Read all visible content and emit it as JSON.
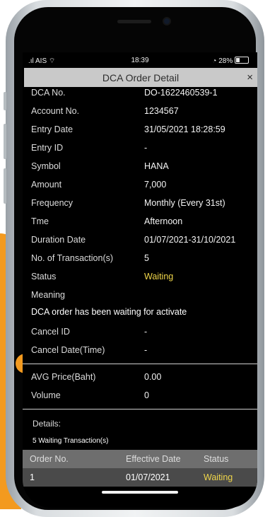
{
  "statusbar": {
    "carrier": ".ıl AIS",
    "time": "18:39",
    "battery": "28%"
  },
  "header": {
    "title": "DCA Order Detail",
    "close": "×"
  },
  "details": [
    {
      "label": "DCA No.",
      "value": "DO-1622460539-1"
    },
    {
      "label": "Account No.",
      "value": "1234567"
    },
    {
      "label": "Entry Date",
      "value": "31/05/2021  18:28:59"
    },
    {
      "label": "Entry ID",
      "value": "-"
    },
    {
      "label": "Symbol",
      "value": "HANA"
    },
    {
      "label": "Amount",
      "value": "7,000"
    },
    {
      "label": "Frequency",
      "value": "Monthly (Every 31st)"
    },
    {
      "label": "Tme",
      "value": "Afternoon"
    },
    {
      "label": "Duration Date",
      "value": "01/07/2021-31/10/2021"
    },
    {
      "label": "No. of Transaction(s)",
      "value": "5"
    },
    {
      "label": "Status",
      "value": "Waiting"
    }
  ],
  "meaning": {
    "label": "Meaning",
    "text": "DCA order has been waiting for activate"
  },
  "cancel": [
    {
      "label": "Cancel ID",
      "value": "-"
    },
    {
      "label": "Cancel Date(Time)",
      "value": "-"
    }
  ],
  "summary": [
    {
      "label": "AVG Price(Baht)",
      "value": "0.00"
    },
    {
      "label": "Volume",
      "value": "0"
    }
  ],
  "details_section": {
    "label": "Details:",
    "waiting": "5 Waiting Transaction(s)"
  },
  "table": {
    "headers": [
      "Order No.",
      "Effective Date",
      "Status"
    ],
    "rows": [
      [
        "1",
        "01/07/2021",
        "Waiting"
      ]
    ]
  },
  "colors": {
    "accent": "#f39a1f",
    "waiting": "#f0d64a",
    "title_bar": "#c9c9c9"
  }
}
